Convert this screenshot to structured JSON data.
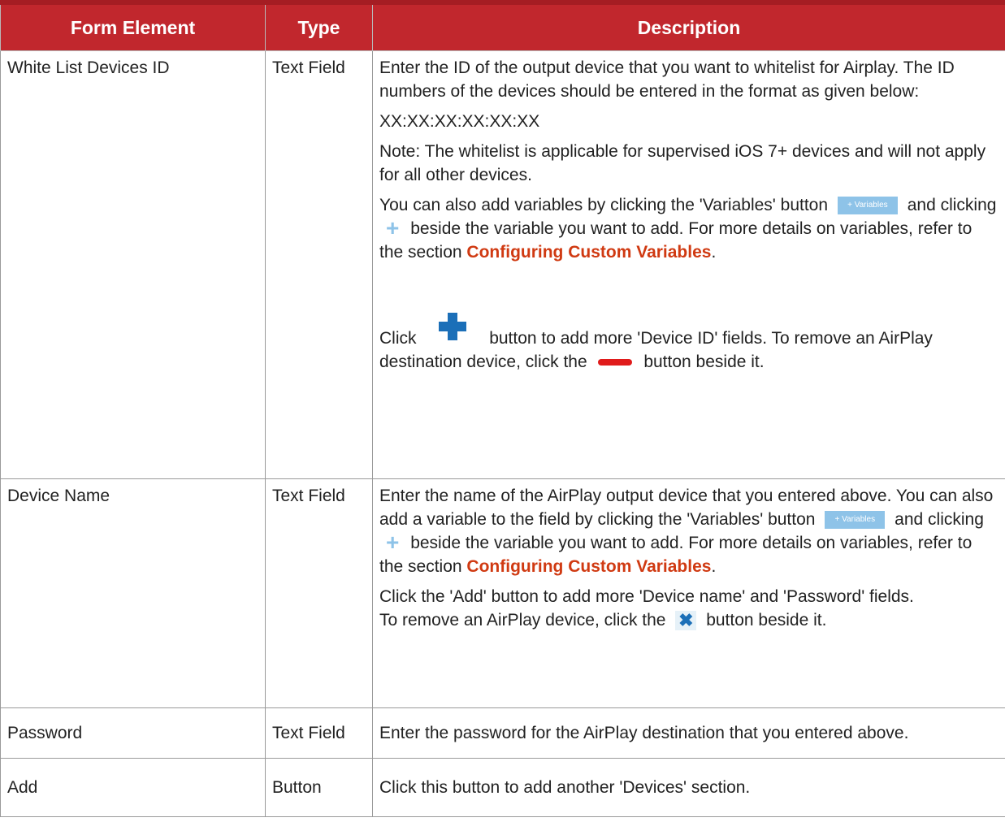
{
  "headers": {
    "form_element": "Form Element",
    "type": "Type",
    "description": "Description"
  },
  "rows": [
    {
      "form_element": "White List Devices ID",
      "type": "Text Field",
      "desc": {
        "p1": "Enter the ID of the output device that you want to whitelist for Airplay. The ID numbers of the devices should be entered in the format as given below:",
        "format": "XX:XX:XX:XX:XX:XX",
        "note": "Note: The whitelist is applicable for supervised iOS 7+ devices and will not apply for all other devices.",
        "vars_a": "You can also add variables by clicking the 'Variables' button",
        "vars_b": "and clicking",
        "vars_c": "beside the variable you want to add. For more details on variables, refer to the section",
        "link": "Configuring Custom Variables",
        "period": ".",
        "click_a": "Click",
        "click_b": "button to add more 'Device ID' fields. To remove an AirPlay destination device, click the",
        "click_c": "button beside it."
      }
    },
    {
      "form_element": "Device Name",
      "type": "Text Field",
      "desc": {
        "p1": "Enter the name of the AirPlay output device that you entered above. You can also add a variable to the field by clicking the 'Variables' button",
        "p1b": "and clicking",
        "p1c": "beside the variable you want to add. For more details on variables, refer to the section",
        "link": "Configuring Custom Variables",
        "period": ".",
        "p2": "Click the 'Add' button to add more 'Device name' and 'Password' fields.",
        "p3a": "To remove an AirPlay device, click the",
        "p3b": "button beside it."
      }
    },
    {
      "form_element": "Password",
      "type": "Text Field",
      "desc": {
        "p1": "Enter the password for the AirPlay destination that you entered above."
      }
    },
    {
      "form_element": "Add",
      "type": "Button",
      "desc": {
        "p1": "Click this button to add another 'Devices' section."
      }
    }
  ],
  "variables_button_label": "+ Variables",
  "icons": {
    "plus_small": "plus-icon",
    "plus_big": "add-field-icon",
    "minus": "remove-icon",
    "close": "close-icon"
  },
  "colors": {
    "header_bg": "#c1272d",
    "link": "#d03a12",
    "variables_button": "#8ec3e8",
    "plus_big": "#1b6fb8",
    "minus": "#e01b1b"
  }
}
